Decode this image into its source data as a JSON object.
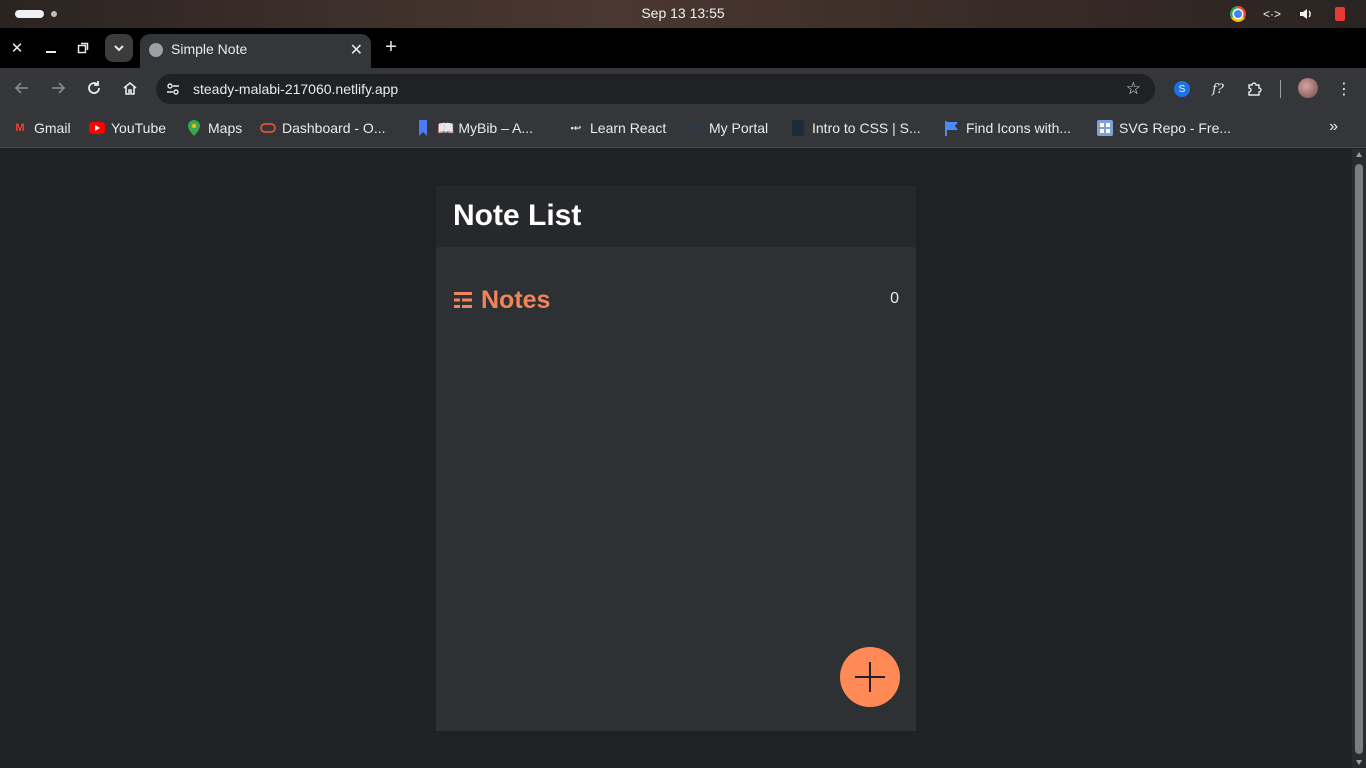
{
  "os": {
    "clock": "Sep 13  13:55"
  },
  "browser": {
    "tab": {
      "title": "Simple Note"
    },
    "address": {
      "url": "steady-malabi-217060.netlify.app"
    },
    "bookmarks": [
      {
        "label": "Gmail",
        "icon": "gmail-icon"
      },
      {
        "label": "YouTube",
        "icon": "youtube-icon"
      },
      {
        "label": "Maps",
        "icon": "maps-icon"
      },
      {
        "label": "Dashboard - O...",
        "icon": "oracle-icon"
      },
      {
        "label": "📖 MyBib – A...",
        "icon": "bookmark-icon"
      },
      {
        "label": "Learn React",
        "icon": "react-icon"
      },
      {
        "label": "My Portal",
        "icon": "portal-icon"
      },
      {
        "label": "Intro to CSS | S...",
        "icon": "css-icon"
      },
      {
        "label": "Find Icons with...",
        "icon": "flag-icon"
      },
      {
        "label": "SVG Repo - Fre...",
        "icon": "svgrepo-icon"
      }
    ]
  },
  "app": {
    "title": "Note List",
    "notes_label": "Notes",
    "notes_count": "0"
  },
  "colors": {
    "accent": "#f1845a",
    "fab": "#ff8a55",
    "panel": "#2e3134",
    "header": "#26282b",
    "page_bg": "#202124"
  }
}
